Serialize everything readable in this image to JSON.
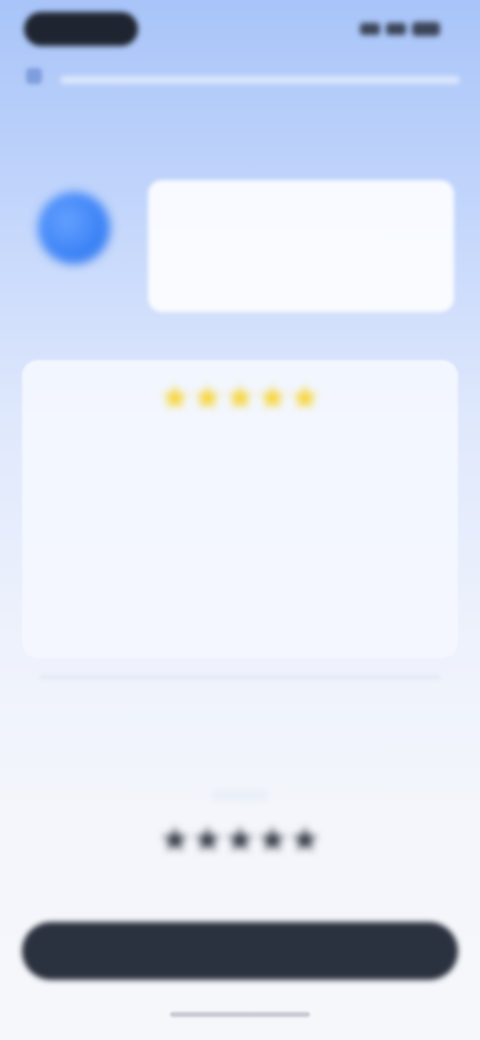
{
  "status_bar": {
    "left_pill_icon": "app-pill",
    "right_icons": [
      "signal-icon",
      "wifi-icon",
      "battery-icon"
    ]
  },
  "header": {
    "back_icon": "back-icon"
  },
  "assistant": {
    "avatar_icon": "assistant-avatar",
    "message": ""
  },
  "rating_card": {
    "stars": [
      "★",
      "★",
      "★",
      "★",
      "★"
    ],
    "star_color": "#f6d32b",
    "title": "",
    "body": ""
  },
  "divider": {
    "label": ""
  },
  "bottom": {
    "stars": [
      "★",
      "★",
      "★",
      "★",
      "★"
    ],
    "caption": ""
  },
  "cta": {
    "label": ""
  },
  "colors": {
    "primary": "#3b82f6",
    "button_bg": "#2b323f",
    "star_yellow": "#f6d32b"
  }
}
